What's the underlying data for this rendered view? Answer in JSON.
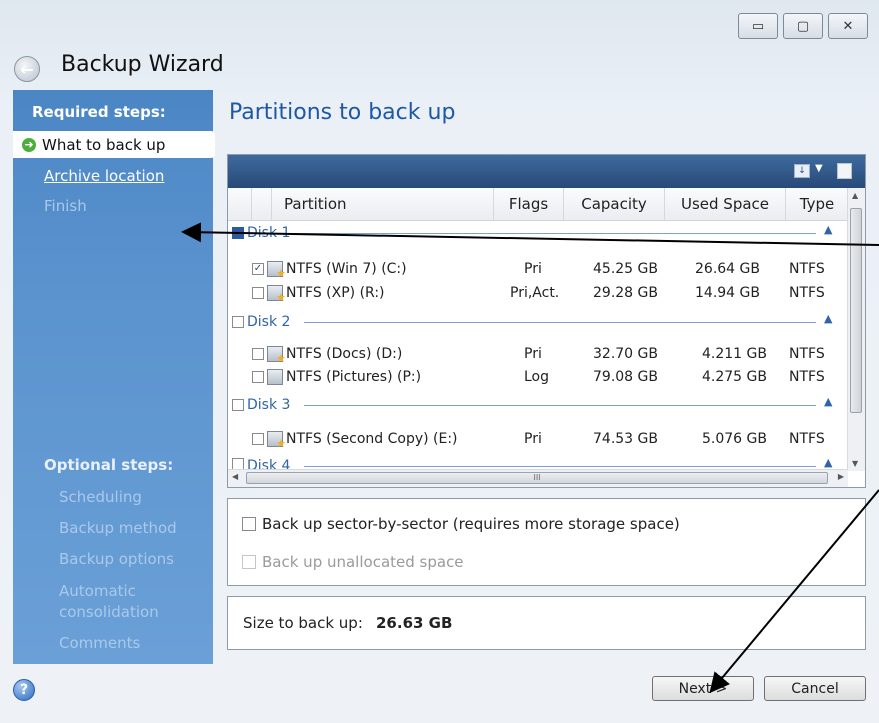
{
  "window": {
    "title": "Backup Wizard",
    "controls": {
      "minimize": "▭",
      "maximize": "▢",
      "close": "✕"
    }
  },
  "sidebar": {
    "required_heading": "Required steps:",
    "required_items": [
      {
        "label": "What to back up",
        "state": "active"
      },
      {
        "label": "Archive location",
        "state": "link"
      },
      {
        "label": "Finish",
        "state": "disabled"
      }
    ],
    "optional_heading": "Optional steps:",
    "optional_items": [
      {
        "label": "Scheduling"
      },
      {
        "label": "Backup method"
      },
      {
        "label": "Backup options"
      },
      {
        "label": "Automatic consolidation"
      },
      {
        "label": "Comments"
      }
    ]
  },
  "main": {
    "title": "Partitions to back up",
    "columns": [
      "Partition",
      "Flags",
      "Capacity",
      "Used Space",
      "Type"
    ],
    "hscroll_grip": "III",
    "disks": [
      {
        "label": "Disk 1",
        "partitions": [
          {
            "name": "NTFS (Win 7) (C:)",
            "flags": "Pri",
            "capacity": "45.25 GB",
            "used": "26.64 GB",
            "type": "NTFS",
            "checked": true,
            "icon": "volume-star-icon"
          },
          {
            "name": "NTFS (XP) (R:)",
            "flags": "Pri,Act.",
            "capacity": "29.28 GB",
            "used": "14.94 GB",
            "type": "NTFS",
            "checked": false,
            "icon": "volume-star-green-icon"
          }
        ]
      },
      {
        "label": "Disk 2",
        "partitions": [
          {
            "name": "NTFS (Docs) (D:)",
            "flags": "Pri",
            "capacity": "32.70 GB",
            "used": "4.211 GB",
            "type": "NTFS",
            "checked": false,
            "icon": "volume-star-icon"
          },
          {
            "name": "NTFS (Pictures) (P:)",
            "flags": "Log",
            "capacity": "79.08 GB",
            "used": "4.275 GB",
            "type": "NTFS",
            "checked": false,
            "icon": "volume-icon"
          }
        ]
      },
      {
        "label": "Disk 3",
        "partitions": [
          {
            "name": "NTFS (Second Copy) (E:)",
            "flags": "Pri",
            "capacity": "74.53 GB",
            "used": "5.076 GB",
            "type": "NTFS",
            "checked": false,
            "icon": "volume-star-icon"
          }
        ]
      },
      {
        "label": "Disk 4",
        "partitions": []
      }
    ],
    "options": {
      "sector_by_sector": "Back up sector-by-sector (requires more storage space)",
      "unallocated": "Back up unallocated space"
    },
    "size_label": "Size to back up:",
    "size_value": "26.63 GB"
  },
  "footer": {
    "next": "Next >",
    "cancel": "Cancel"
  },
  "colors": {
    "sidebar": "#5b93cf",
    "title_blue": "#1d58a6",
    "toolbar": "#2f5688"
  }
}
